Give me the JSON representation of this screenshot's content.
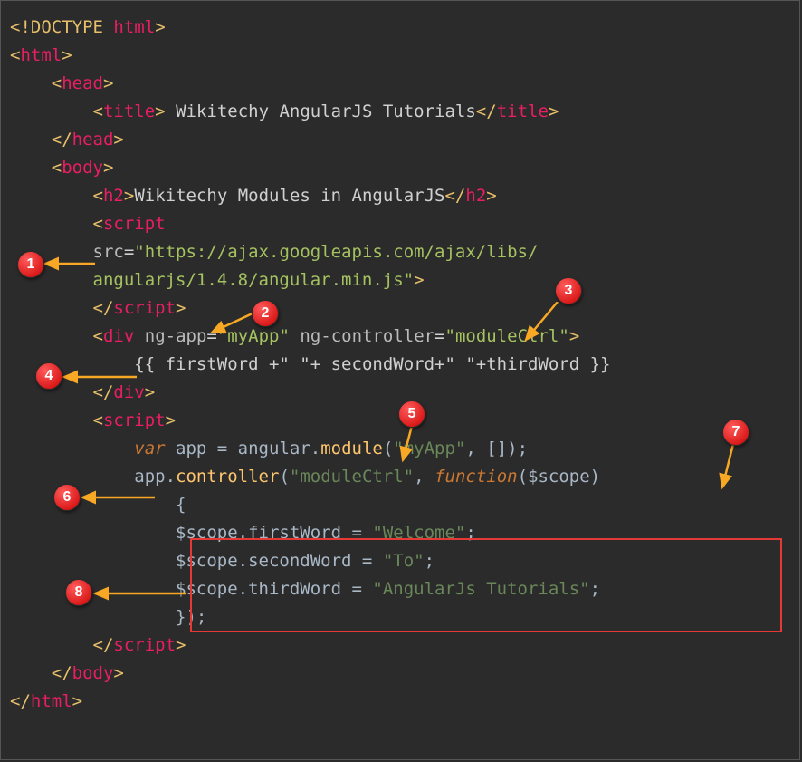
{
  "lines": {
    "l1_a": "<!",
    "l1_b": "DOCTYPE",
    "l1_c": " ",
    "l1_d": "html",
    "l1_e": ">",
    "l2_a": "<",
    "l2_b": "html",
    "l2_c": ">",
    "l3_a": "<",
    "l3_b": "head",
    "l3_c": ">",
    "l4_a": "<",
    "l4_b": "title",
    "l4_c": ">",
    "l4_d": " Wikitechy AngularJS Tutorials",
    "l4_e": "</",
    "l4_f": "title",
    "l4_g": ">",
    "l5_a": "</",
    "l5_b": "head",
    "l5_c": ">",
    "l6_a": "<",
    "l6_b": "body",
    "l6_c": ">",
    "l7_a": "<",
    "l7_b": "h2",
    "l7_c": ">",
    "l7_d": "Wikitechy Modules in AngularJS",
    "l7_e": "</",
    "l7_f": "h2",
    "l7_g": ">",
    "l8_a": "<",
    "l8_b": "script",
    "l9_a": "src",
    "l9_b": "=",
    "l9_c": "\"https://ajax.googleapis.com/ajax/libs/",
    "l10_a": "angularjs/1.4.8/angular.min.js\"",
    "l10_b": ">",
    "l11_a": "</",
    "l11_b": "script",
    "l11_c": ">",
    "l12_a": "<",
    "l12_b": "div",
    "l12_c": " ",
    "l12_d": "ng-app",
    "l12_e": "=",
    "l12_f": "\"myApp\"",
    "l12_g": " ",
    "l12_h": "ng-controller",
    "l12_i": "=",
    "l12_j": "\"moduleCtrl\"",
    "l12_k": ">",
    "l13_a": "{{ firstWord +\" \"+ secondWord+\" \"+thirdWord }}",
    "l14_a": "</",
    "l14_b": "div",
    "l14_c": ">",
    "l15_a": "<",
    "l15_b": "script",
    "l15_c": ">",
    "l16_a": "var",
    "l16_b": " app = angular.",
    "l16_c": "module",
    "l16_d": "(",
    "l16_e": "\"myApp\"",
    "l16_f": ", []);",
    "l17_a": "app.",
    "l17_b": "controller",
    "l17_c": "(",
    "l17_d": "\"moduleCtrl\"",
    "l17_e": ", ",
    "l17_f": "function",
    "l17_g": "($scope)",
    "l18_a": "{",
    "l19_a": "$scope.firstWord = ",
    "l19_b": "\"Welcome\"",
    "l19_c": ";",
    "l20_a": "$scope.secondWord = ",
    "l20_b": "\"To\"",
    "l20_c": ";",
    "l21_a": "$scope.thirdWord = ",
    "l21_b": "\"AngularJs Tutorials\"",
    "l21_c": ";",
    "l22_a": "});",
    "l23_a": "</",
    "l23_b": "script",
    "l23_c": ">",
    "l24_a": "</",
    "l24_b": "body",
    "l24_c": ">",
    "l25_a": "</",
    "l25_b": "html",
    "l25_c": ">"
  },
  "markers": {
    "m1": "1",
    "m2": "2",
    "m3": "3",
    "m4": "4",
    "m5": "5",
    "m6": "6",
    "m7": "7",
    "m8": "8"
  }
}
